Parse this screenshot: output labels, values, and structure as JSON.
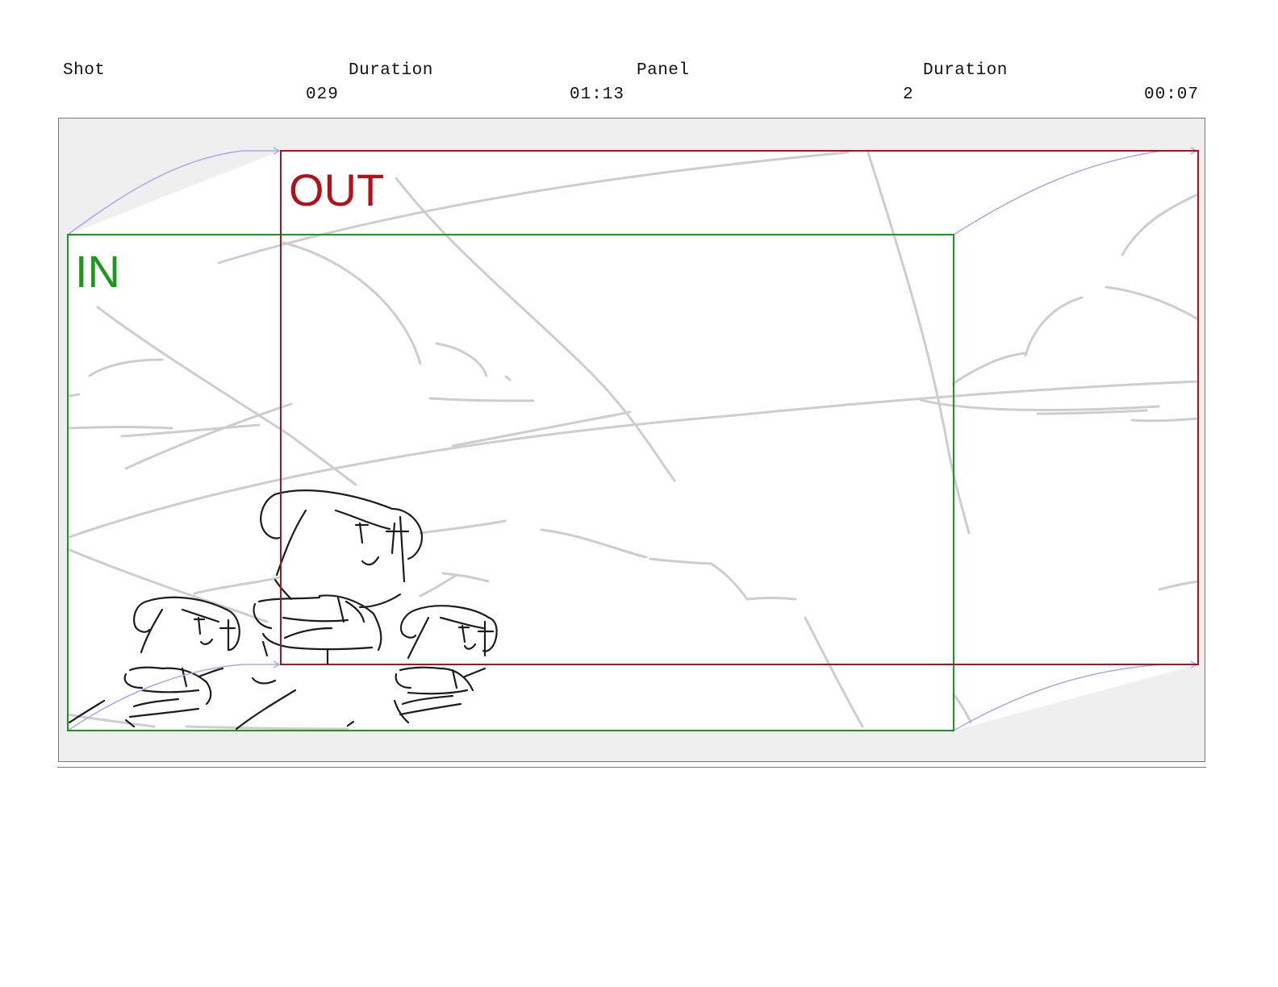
{
  "header": {
    "shot_label": "Shot",
    "shot_duration_label": "Duration",
    "panel_label": "Panel",
    "panel_duration_label": "Duration",
    "shot_value": "029",
    "shot_duration_value": "01:13",
    "panel_value": "2",
    "panel_duration_value": "00:07"
  },
  "frames": {
    "in_label": "IN",
    "out_label": "OUT",
    "in_color": "#1a9a1a",
    "out_color": "#b0121a",
    "motion_path_color": "#a8a8e6"
  },
  "colors": {
    "canvas_background": "#efefef",
    "sketch_background": "#ffffff",
    "background_line_color": "#cdcdcd",
    "character_line_color": "#1c1c1c"
  }
}
